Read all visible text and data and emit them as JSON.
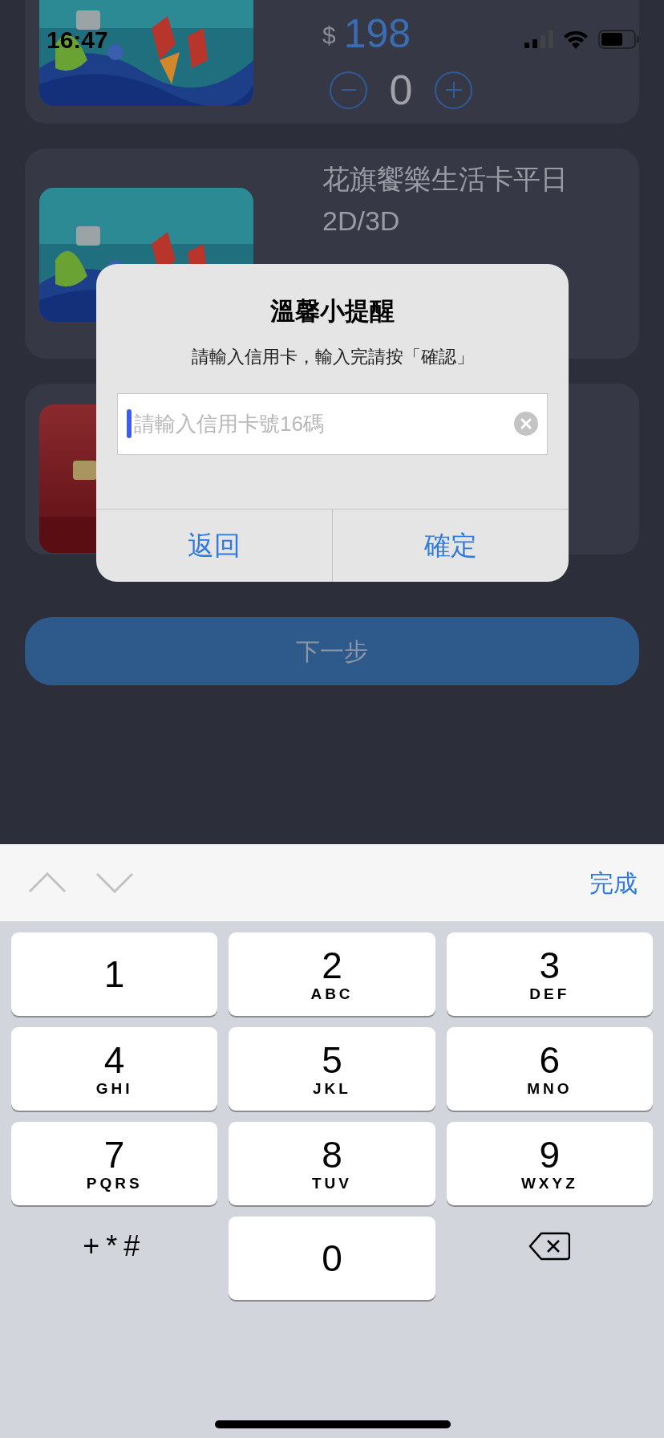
{
  "status_bar": {
    "time": "16:47"
  },
  "cards": [
    {
      "kind": "teal",
      "currency": "$",
      "price": "198",
      "quantity": "0"
    },
    {
      "kind": "teal",
      "title": "花旗饗樂生活卡平日2D/3D"
    },
    {
      "kind": "red"
    }
  ],
  "next_button": "下一步",
  "dialog": {
    "title": "溫馨小提醒",
    "message": "請輸入信用卡，輸入完請按「確認」",
    "input": {
      "placeholder": "請輸入信用卡號16碼"
    },
    "buttons": [
      "返回",
      "確定"
    ]
  },
  "keyboard": {
    "done": "完成",
    "keys": [
      {
        "kind": "digit",
        "digit": "1"
      },
      {
        "kind": "digit",
        "digit": "2",
        "letters": "ABC"
      },
      {
        "kind": "digit",
        "digit": "3",
        "letters": "DEF"
      },
      {
        "kind": "digit",
        "digit": "4",
        "letters": "GHI"
      },
      {
        "kind": "digit",
        "digit": "5",
        "letters": "JKL"
      },
      {
        "kind": "digit",
        "digit": "6",
        "letters": "MNO"
      },
      {
        "kind": "digit",
        "digit": "7",
        "letters": "PQRS"
      },
      {
        "kind": "digit",
        "digit": "8",
        "letters": "TUV"
      },
      {
        "kind": "digit",
        "digit": "9",
        "letters": "WXYZ"
      },
      {
        "kind": "symbols",
        "digit": "+*#"
      },
      {
        "kind": "digit",
        "digit": "0"
      },
      {
        "kind": "delete"
      }
    ]
  }
}
